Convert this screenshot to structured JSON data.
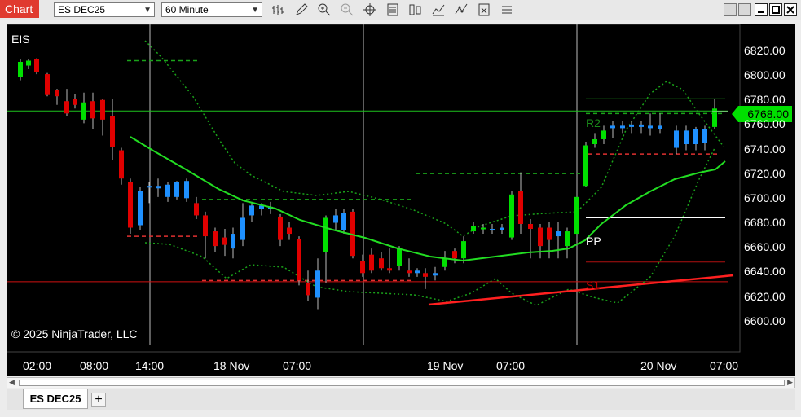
{
  "toolbar": {
    "chart_label": "Chart",
    "instrument_select": "ES DEC25",
    "interval_select": "60 Minute",
    "icons": [
      "bars-type-icon",
      "draw-pencil-icon",
      "zoom-in-icon",
      "zoom-out-icon",
      "crosshair-icon",
      "properties-icon",
      "bars-icon",
      "indicators-icon",
      "strategies-icon",
      "data-box-icon"
    ]
  },
  "chart": {
    "instrument_label": "EIS",
    "copyright": "© 2025 NinjaTrader, LLC",
    "current_price": "6768.00",
    "levels": {
      "r2": "R2",
      "pp": "PP",
      "s1": "S1"
    },
    "y_ticks": [
      "6820.00",
      "6800.00",
      "6780.00",
      "6760.00",
      "6740.00",
      "6720.00",
      "6700.00",
      "6680.00",
      "6660.00",
      "6640.00",
      "6620.00",
      "6600.00"
    ],
    "x_ticks": [
      "02:00",
      "08:00",
      "14:00",
      "18 Nov",
      "07:00",
      "19 Nov",
      "07:00",
      "20 Nov",
      "07:00"
    ],
    "colors": {
      "up": "#00e000",
      "down": "#e00000",
      "neutral": "#1e90ff",
      "sma": "#22dd22",
      "band": "#1aa31a"
    }
  },
  "tabs": {
    "active": "ES DEC25",
    "add": "+"
  }
}
